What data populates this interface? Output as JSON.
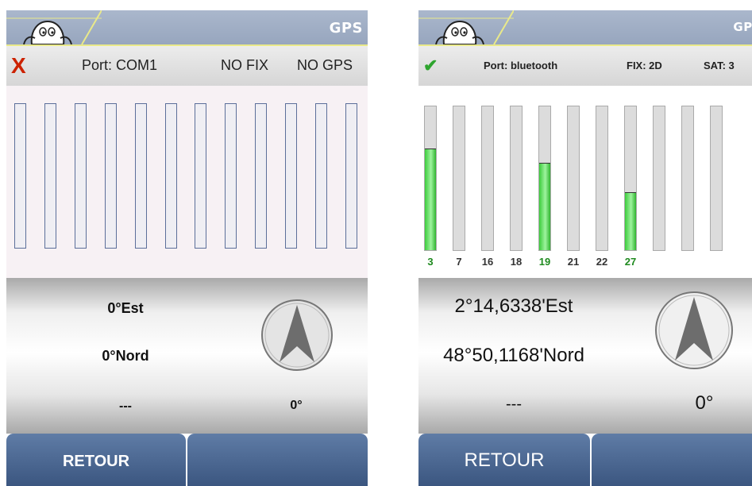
{
  "colors": {
    "titlebar": "#a3b1c8",
    "accent_line": "#e9e98a",
    "button": "#4a6690",
    "fix_green": "#1f8a1f",
    "error_red": "#cc2200"
  },
  "left": {
    "title": "GPS",
    "status": {
      "icon": "x-error-icon",
      "icon_glyph": "X",
      "port": "Port: COM1",
      "fix": "NO FIX",
      "sat": "NO GPS"
    },
    "satellites": [
      {
        "level": 0
      },
      {
        "level": 0
      },
      {
        "level": 0
      },
      {
        "level": 0
      },
      {
        "level": 0
      },
      {
        "level": 0
      },
      {
        "level": 0
      },
      {
        "level": 0
      },
      {
        "level": 0
      },
      {
        "level": 0
      },
      {
        "level": 0
      },
      {
        "level": 0
      }
    ],
    "position": {
      "longitude": "0°Est",
      "latitude": "0°Nord",
      "altitude": "---",
      "heading": "0°"
    },
    "buttons": {
      "back": "RETOUR",
      "second": ""
    }
  },
  "right": {
    "title": "GPS",
    "status": {
      "icon": "checkmark-icon",
      "icon_glyph": "✔",
      "port": "Port: bluetooth",
      "fix": "FIX: 2D",
      "sat": "SAT: 3"
    },
    "satellites": [
      {
        "id": "3",
        "level": 0.7,
        "active": true
      },
      {
        "id": "7",
        "level": 0,
        "active": false
      },
      {
        "id": "16",
        "level": 0,
        "active": false
      },
      {
        "id": "18",
        "level": 0,
        "active": false
      },
      {
        "id": "19",
        "level": 0.6,
        "active": true
      },
      {
        "id": "21",
        "level": 0,
        "active": false
      },
      {
        "id": "22",
        "level": 0,
        "active": false
      },
      {
        "id": "27",
        "level": 0.4,
        "active": true
      },
      {
        "level": 0
      },
      {
        "level": 0
      },
      {
        "level": 0
      }
    ],
    "position": {
      "longitude": "2°14,6338'Est",
      "latitude": "48°50,1168'Nord",
      "altitude": "---",
      "heading": "0°"
    },
    "buttons": {
      "back": "RETOUR",
      "second": ""
    }
  }
}
